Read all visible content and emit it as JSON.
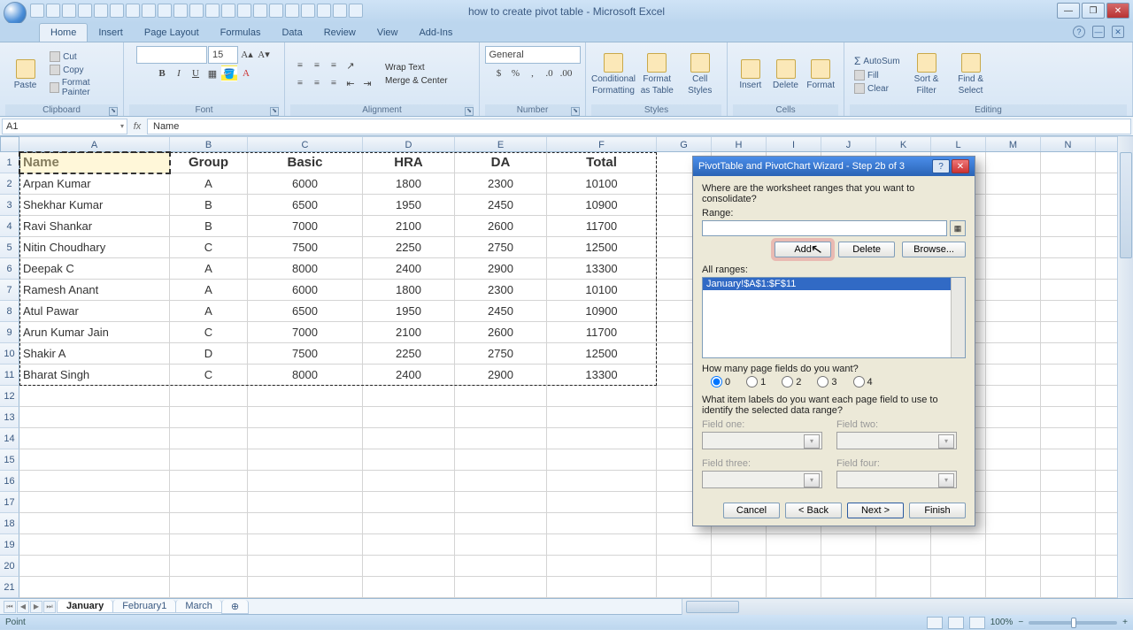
{
  "window": {
    "title": "how to create pivot table - Microsoft Excel"
  },
  "ribbon": {
    "tabs": [
      "Home",
      "Insert",
      "Page Layout",
      "Formulas",
      "Data",
      "Review",
      "View",
      "Add-Ins"
    ],
    "active": "Home",
    "clipboard": {
      "paste": "Paste",
      "cut": "Cut",
      "copy": "Copy",
      "fp": "Format Painter",
      "grp": "Clipboard"
    },
    "font": {
      "grp": "Font",
      "size": "15",
      "bold": "B",
      "italic": "I",
      "underline": "U"
    },
    "alignment": {
      "grp": "Alignment",
      "wrap": "Wrap Text",
      "merge": "Merge & Center"
    },
    "number": {
      "grp": "Number",
      "general": "General"
    },
    "styles": {
      "grp": "Styles",
      "cf": "Conditional",
      "cf2": "Formatting",
      "fat": "Format",
      "fat2": "as Table",
      "cs": "Cell",
      "cs2": "Styles"
    },
    "cells": {
      "grp": "Cells",
      "ins": "Insert",
      "del": "Delete",
      "fmt": "Format"
    },
    "editing": {
      "grp": "Editing",
      "sum": "AutoSum",
      "fill": "Fill",
      "clear": "Clear",
      "sort": "Sort &",
      "sort2": "Filter",
      "find": "Find &",
      "find2": "Select"
    }
  },
  "fx": {
    "ref": "A1",
    "label": "fx",
    "value": "Name"
  },
  "cols": [
    "A",
    "B",
    "C",
    "D",
    "E",
    "F",
    "G",
    "H",
    "I",
    "J",
    "K",
    "L",
    "M",
    "N"
  ],
  "headers": [
    "Name",
    "Group",
    "Basic",
    "HRA",
    "DA",
    "Total"
  ],
  "rows": [
    [
      "Arpan Kumar",
      "A",
      "6000",
      "1800",
      "2300",
      "10100"
    ],
    [
      "Shekhar Kumar",
      "B",
      "6500",
      "1950",
      "2450",
      "10900"
    ],
    [
      "Ravi Shankar",
      "B",
      "7000",
      "2100",
      "2600",
      "11700"
    ],
    [
      "Nitin Choudhary",
      "C",
      "7500",
      "2250",
      "2750",
      "12500"
    ],
    [
      "Deepak C",
      "A",
      "8000",
      "2400",
      "2900",
      "13300"
    ],
    [
      "Ramesh Anant",
      "A",
      "6000",
      "1800",
      "2300",
      "10100"
    ],
    [
      "Atul Pawar",
      "A",
      "6500",
      "1950",
      "2450",
      "10900"
    ],
    [
      "Arun Kumar Jain",
      "C",
      "7000",
      "2100",
      "2600",
      "11700"
    ],
    [
      "Shakir A",
      "D",
      "7500",
      "2250",
      "2750",
      "12500"
    ],
    [
      "Bharat Singh",
      "C",
      "8000",
      "2400",
      "2900",
      "13300"
    ]
  ],
  "sheets": {
    "s1": "January",
    "s2": "February1",
    "s3": "March"
  },
  "status": {
    "mode": "Point",
    "zoom": "100%"
  },
  "dialog": {
    "title": "PivotTable and PivotChart Wizard - Step 2b of 3",
    "prompt": "Where are the worksheet ranges that you want to consolidate?",
    "range_label": "Range:",
    "range_value": "January!$A$1:$F$11",
    "add": "Add",
    "delete": "Delete",
    "browse": "Browse...",
    "all_ranges_label": "All ranges:",
    "all_ranges_item": "January!$A$1:$F$11",
    "pf_prompt": "How many page fields do you want?",
    "r0": "0",
    "r1": "1",
    "r2": "2",
    "r3": "3",
    "r4": "4",
    "item_prompt": "What item labels do you want each page field to use to identify the selected data range?",
    "f1": "Field one:",
    "f2": "Field two:",
    "f3": "Field three:",
    "f4": "Field four:",
    "cancel": "Cancel",
    "back": "< Back",
    "next": "Next >",
    "finish": "Finish"
  }
}
